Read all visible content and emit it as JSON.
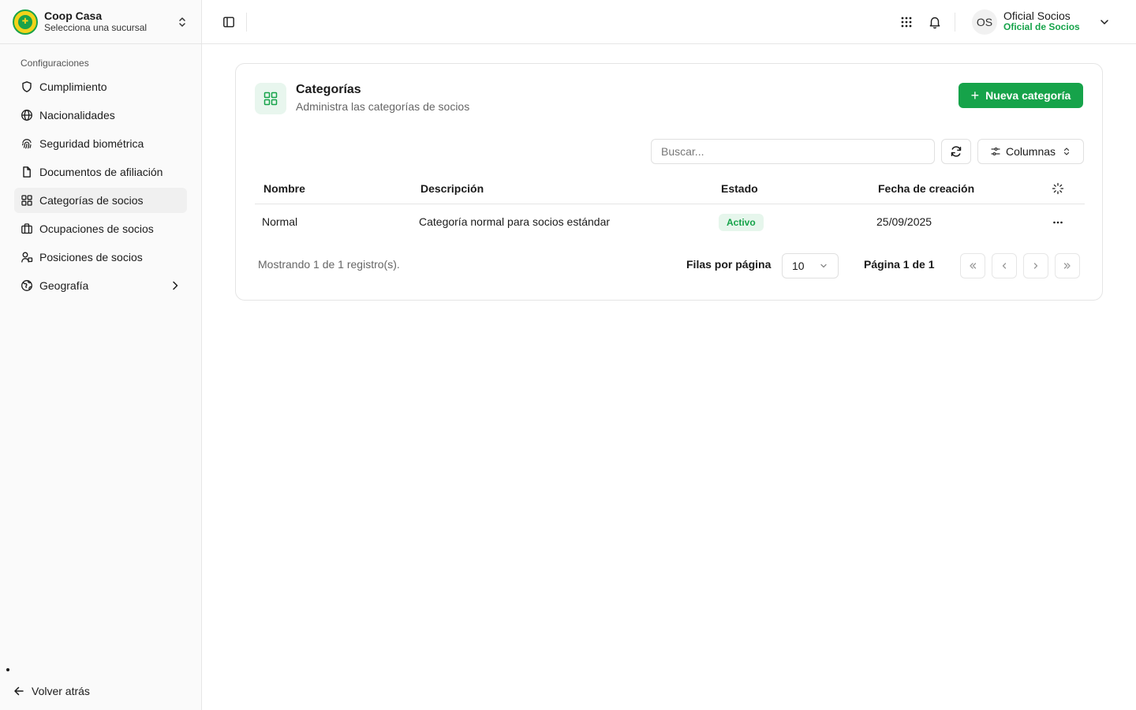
{
  "org": {
    "name": "Coop Casa",
    "subtitle": "Selecciona una sucursal"
  },
  "sidebar": {
    "section_title": "Configuraciones",
    "items": [
      {
        "label": "Cumplimiento",
        "icon": "shield-icon"
      },
      {
        "label": "Nacionalidades",
        "icon": "globe-icon"
      },
      {
        "label": "Seguridad biométrica",
        "icon": "fingerprint-icon"
      },
      {
        "label": "Documentos de afiliación",
        "icon": "file-icon"
      },
      {
        "label": "Categorías de socios",
        "icon": "grid-icon",
        "active": true
      },
      {
        "label": "Ocupaciones de socios",
        "icon": "briefcase-icon"
      },
      {
        "label": "Posiciones de socios",
        "icon": "users-icon"
      },
      {
        "label": "Geografía",
        "icon": "earth-icon",
        "has_submenu": true
      }
    ],
    "back_label": "Volver atrás"
  },
  "header": {
    "avatar_initials": "OS",
    "user_name": "Oficial Socios",
    "user_role": "Oficial de Socios"
  },
  "page": {
    "title": "Categorías",
    "subtitle": "Administra las categorías de socios",
    "new_button_label": "Nueva categoría",
    "search_placeholder": "Buscar...",
    "columns_button_label": "Columnas"
  },
  "table": {
    "columns": [
      "Nombre",
      "Descripción",
      "Estado",
      "Fecha de creación"
    ],
    "rows": [
      {
        "nombre": "Normal",
        "descripcion": "Categoría normal para socios estándar",
        "estado": "Activo",
        "fecha": "25/09/2025"
      }
    ]
  },
  "pagination": {
    "info": "Mostrando 1 de 1 registro(s).",
    "rows_per_page_label": "Filas por página",
    "rows_per_page_value": "10",
    "page_label": "Página 1 de 1"
  },
  "colors": {
    "accent": "#16a34a",
    "badge_bg": "#e6f6ec",
    "sidebar_bg": "#fafafa"
  }
}
